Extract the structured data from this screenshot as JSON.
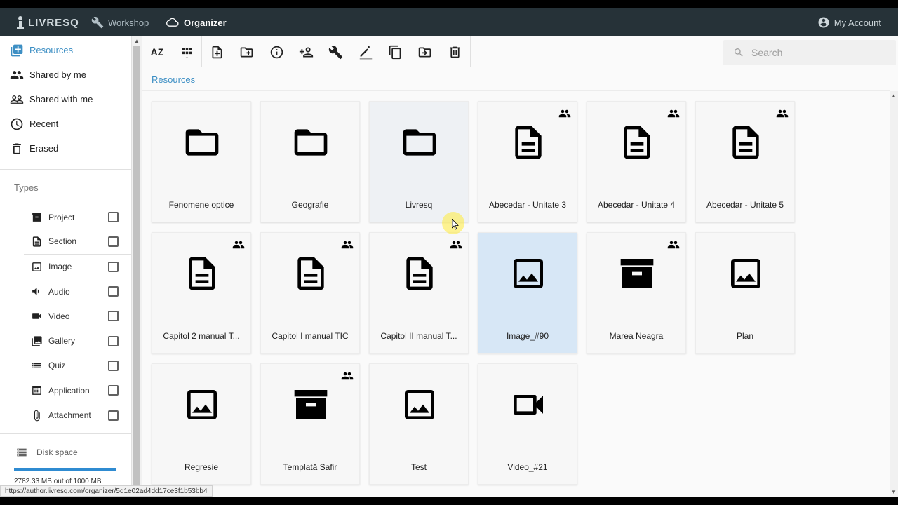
{
  "topbar": {
    "logo_text": "LIVRESQ",
    "nav": [
      {
        "label": "Workshop",
        "icon": "wrench-icon"
      },
      {
        "label": "Organizer",
        "icon": "cloud-icon"
      }
    ],
    "account_label": "My Account"
  },
  "sidebar": {
    "nav_items": [
      {
        "label": "Resources",
        "icon": "folder-stack-icon",
        "active": true
      },
      {
        "label": "Shared by me",
        "icon": "people-icon"
      },
      {
        "label": "Shared with me",
        "icon": "people-outline-icon"
      },
      {
        "label": "Recent",
        "icon": "clock-icon"
      },
      {
        "label": "Erased",
        "icon": "trash-icon"
      }
    ],
    "types_title": "Types",
    "types": [
      {
        "label": "Project",
        "icon": "archive-icon",
        "checked": false
      },
      {
        "label": "Section",
        "icon": "document-icon",
        "checked": false
      },
      {
        "label": "Image",
        "icon": "image-icon",
        "checked": false
      },
      {
        "label": "Audio",
        "icon": "speaker-icon",
        "checked": false
      },
      {
        "label": "Video",
        "icon": "video-camera-icon",
        "checked": false
      },
      {
        "label": "Gallery",
        "icon": "gallery-icon",
        "checked": false
      },
      {
        "label": "Quiz",
        "icon": "list-icon",
        "checked": false
      },
      {
        "label": "Application",
        "icon": "grid-app-icon",
        "checked": false
      },
      {
        "label": "Attachment",
        "icon": "paperclip-icon",
        "checked": false
      }
    ],
    "disk": {
      "title": "Disk space",
      "usage_text": "2782.33 MB out of 1000 MB",
      "fill_fraction": 1.0
    }
  },
  "toolbar": {
    "sort_label": "AZ",
    "buttons": [
      "sort-az-icon",
      "grid-view-icon",
      "new-file-icon",
      "new-folder-icon",
      "info-icon",
      "add-person-icon",
      "wrench-icon",
      "edit-icon",
      "copy-icon",
      "move-icon",
      "delete-icon"
    ],
    "search_placeholder": "Search"
  },
  "breadcrumb": "Resources",
  "items": [
    {
      "label": "Fenomene optice",
      "icon": "folder",
      "shared": false
    },
    {
      "label": "Geografie",
      "icon": "folder",
      "shared": false
    },
    {
      "label": "Livresq",
      "icon": "folder",
      "shared": false,
      "state": "hover"
    },
    {
      "label": "Abecedar - Unitate 3",
      "icon": "document",
      "shared": true
    },
    {
      "label": "Abecedar - Unitate 4",
      "icon": "document",
      "shared": true
    },
    {
      "label": "Abecedar - Unitate 5",
      "icon": "document",
      "shared": true
    },
    {
      "label": "Capitol 2 manual T...",
      "icon": "document",
      "shared": true
    },
    {
      "label": "Capitol I manual TIC",
      "icon": "document",
      "shared": true
    },
    {
      "label": "Capitol II manual T...",
      "icon": "document",
      "shared": true
    },
    {
      "label": "Image_#90",
      "icon": "image",
      "shared": false,
      "state": "selected"
    },
    {
      "label": "Marea Neagra",
      "icon": "archive",
      "shared": true
    },
    {
      "label": "Plan",
      "icon": "image",
      "shared": false
    },
    {
      "label": "Regresie",
      "icon": "image",
      "shared": false
    },
    {
      "label": "Templată Safir",
      "icon": "archive",
      "shared": true
    },
    {
      "label": "Test",
      "icon": "image",
      "shared": false
    },
    {
      "label": "Video_#21",
      "icon": "video",
      "shared": false
    }
  ],
  "status_url": "https://author.livresq.com/organizer/5d1e02ad4dd17ce3f1b53bb4"
}
